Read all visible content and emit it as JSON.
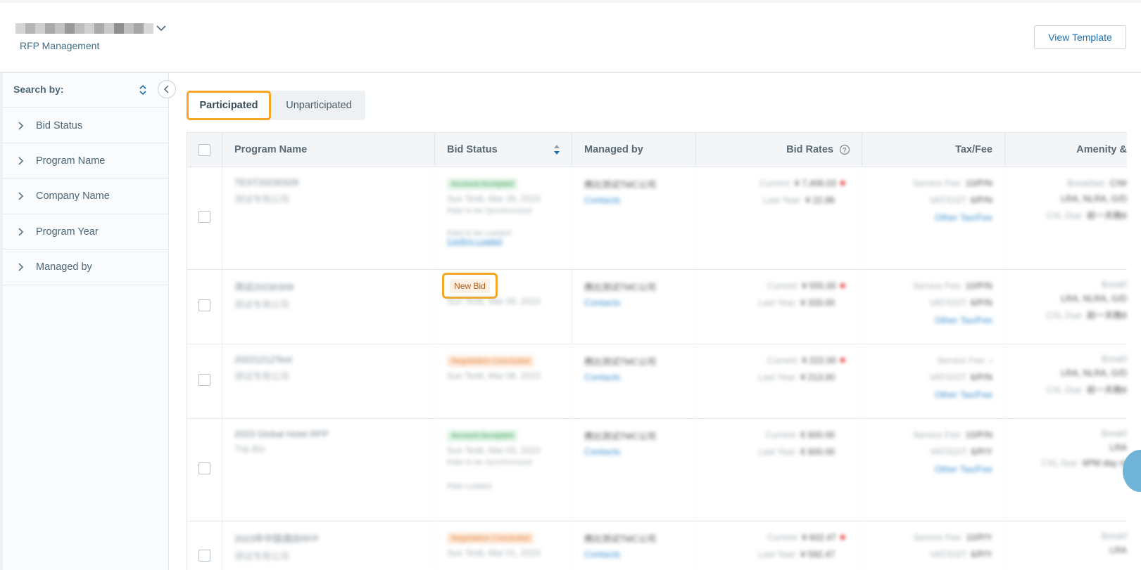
{
  "header": {
    "app_subtitle": "RFP Management",
    "view_template_label": "View Template"
  },
  "sidebar": {
    "search_by_label": "Search by:",
    "filters": [
      {
        "label": "Bid Status"
      },
      {
        "label": "Program Name"
      },
      {
        "label": "Company Name"
      },
      {
        "label": "Program Year"
      },
      {
        "label": "Managed by"
      }
    ]
  },
  "tabs": [
    {
      "label": "Participated",
      "active": true
    },
    {
      "label": "Unparticipated",
      "active": false
    }
  ],
  "table": {
    "columns": [
      "Program Name",
      "Bid Status",
      "Managed by",
      "Bid Rates",
      "Tax/Fee",
      "Amenity &"
    ],
    "rows": [
      {
        "program_name": "TEST20230329",
        "company": "测试专用公司",
        "status_badge": "Account Accepted",
        "status_color": "green",
        "status_date": "Sun Testt, Mar 29, 2023",
        "sync_line_1": "Rate to be Synchronized",
        "sync_line_2": "Rate to be Loaded",
        "confirm_link": "Confirm Loaded",
        "managed_by": "携比测试TMC公司",
        "contacts": "Contacts",
        "current_label": "Current:",
        "current_rate": "¥ 7,406.03",
        "last_year_label": "Last Year:",
        "last_year_rate": "¥ 22.86",
        "tax_line_1_label": "Service Fee:",
        "tax_line_1_value": "10/P/N",
        "tax_line_2_label": "VAT/GST:",
        "tax_line_2_value": "6/P/N",
        "tax_link": "Other Tax/Fee",
        "amenity_1_label": "Breakfast:",
        "amenity_1_value": "C/W",
        "amenity_2": "LRA, NLRA, G/D",
        "amenity_3_label": "CXL Due:",
        "amenity_3_value": "前一天晚6"
      },
      {
        "program_name": "测试20230309",
        "company": "测试专用公司",
        "status_badge": "New Bid",
        "status_date": "Sun Testt, Mar 09, 2023",
        "managed_by": "携比测试TMC公司",
        "contacts": "Contacts",
        "current_label": "Current:",
        "current_rate": "¥ 555.00",
        "last_year_label": "Last Year:",
        "last_year_rate": "¥ 333.00",
        "tax_line_1_label": "Service Fee:",
        "tax_line_1_value": "10/P/N",
        "tax_line_2_label": "VAT/GST:",
        "tax_line_2_value": "6/P/N",
        "tax_link": "Other Tax/Fee",
        "amenity_1_label": "Breakf",
        "amenity_2": "LRA, NLRA, G/D",
        "amenity_3_label": "CXL Due:",
        "amenity_3_value": "前一天晚6"
      },
      {
        "program_name": "20221212Test",
        "company": "测试专用公司",
        "status_badge": "Negotiation Concluded",
        "status_color": "orange",
        "status_date": "Sun Testt, Mar 08, 2023",
        "managed_by": "携比测试TMC公司",
        "contacts": "Contacts",
        "current_label": "Current:",
        "current_rate": "¥ 222.00",
        "last_year_label": "Last Year:",
        "last_year_rate": "¥ 213.00",
        "tax_line_1_label": "Service Fee:",
        "tax_line_1_value": "-",
        "tax_line_2_label": "VAT/GST:",
        "tax_line_2_value": "6/P/N",
        "tax_link": "Other Tax/Fee",
        "amenity_1_label": "Breakf",
        "amenity_2": "LRA, NLRA, G/D",
        "amenity_3_label": "CXL Due:",
        "amenity_3_value": "前一天晚6"
      },
      {
        "program_name": "2023 Global Hotel RFP",
        "company": "Trip.Biz",
        "status_badge": "Account Accepted",
        "status_color": "green",
        "status_date": "Sun Testt, Mar 03, 2023",
        "sync_line_1": "Rate to be Synchronized",
        "sync_line_2": "Rate Loaded",
        "managed_by": "携比测试TMC公司",
        "contacts": "Contacts",
        "current_label": "Current:",
        "current_rate": "€ 600.00",
        "last_year_label": "Last Year:",
        "last_year_rate": "€ 600.00",
        "tax_line_1_label": "Service Fee:",
        "tax_line_1_value": "10/P/N",
        "tax_line_2_label": "VAT/GST:",
        "tax_line_2_value": "6/P/Y",
        "tax_link": "Other Tax/Fee",
        "amenity_1_label": "Breakf",
        "amenity_2": "LRA",
        "amenity_3_label": "CXL Due:",
        "amenity_3_value": "6PM day of"
      },
      {
        "program_name": "2023年中国酒店RFP",
        "company": "测试专用公司",
        "status_badge": "Negotiation Concluded",
        "status_color": "orange",
        "status_date": "Sun Testt, Mar 01, 2023",
        "managed_by": "携比测试TMC公司",
        "contacts": "Contacts",
        "current_label": "Current:",
        "current_rate": "¥ 602.47",
        "last_year_label": "Last Year:",
        "last_year_rate": "¥ 592.47",
        "tax_line_1_label": "Service Fee:",
        "tax_line_1_value": "10/P/Y",
        "tax_line_2_label": "VAT/GST:",
        "tax_line_2_value": "6/P/Y",
        "amenity_1_label": "Breakf",
        "amenity_2": "LRA"
      }
    ]
  },
  "colors": {
    "highlight": "#f5a623",
    "link": "#1a73b8",
    "rate_dot": "#e53935"
  }
}
